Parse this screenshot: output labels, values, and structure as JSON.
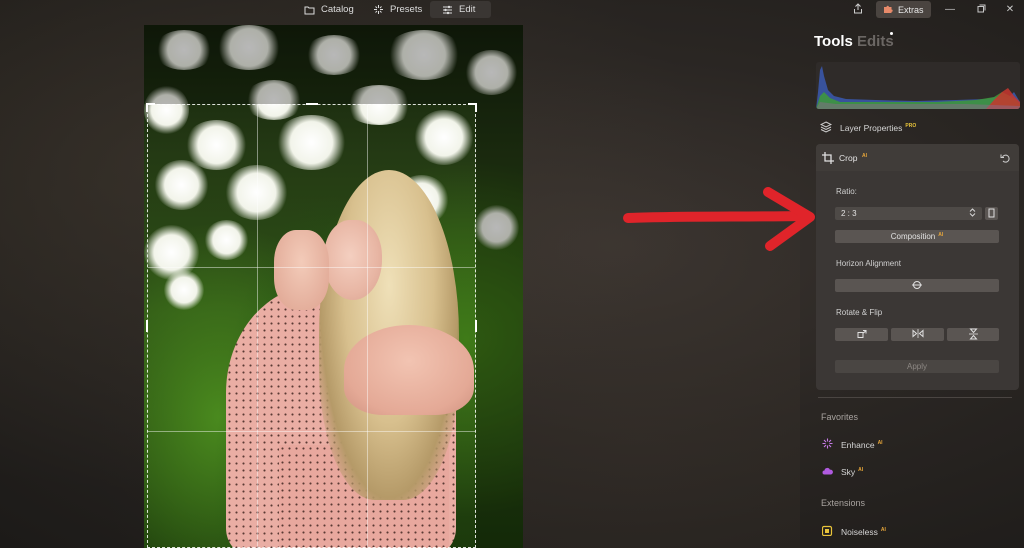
{
  "tabs": [
    {
      "label": "Catalog",
      "icon": "folder-icon"
    },
    {
      "label": "Presets",
      "icon": "sparkle-icon"
    },
    {
      "label": "Edit",
      "icon": "sliders-icon"
    }
  ],
  "header_right": {
    "extras_label": "Extras",
    "icons": [
      "share-icon",
      "puzzle-icon",
      "minimize-icon",
      "restore-icon",
      "close-icon"
    ]
  },
  "panel": {
    "tab_tools": "Tools",
    "tab_edits": "Edits"
  },
  "layer_properties": {
    "label": "Layer Properties",
    "badge": "PRO"
  },
  "crop": {
    "title": "Crop",
    "badge": "AI",
    "ratio_label": "Ratio:",
    "ratio_value": "2 : 3",
    "composition_label": "Composition",
    "composition_badge": "AI",
    "horizon_label": "Horizon Alignment",
    "rotate_label": "Rotate & Flip",
    "apply_label": "Apply"
  },
  "favorites": {
    "title": "Favorites",
    "items": [
      {
        "label": "Enhance",
        "badge": "AI",
        "icon": "enhance-icon",
        "color": "#c77be8"
      },
      {
        "label": "Sky",
        "badge": "AI",
        "icon": "cloud-icon",
        "color": "#b05be0"
      }
    ]
  },
  "extensions": {
    "title": "Extensions",
    "items": [
      {
        "label": "Noiseless",
        "badge": "AI",
        "icon": "noiseless-icon",
        "color": "#e8c43a"
      }
    ]
  },
  "colors": {
    "accent": "#e8a73a",
    "arrow": "#e0242a"
  }
}
